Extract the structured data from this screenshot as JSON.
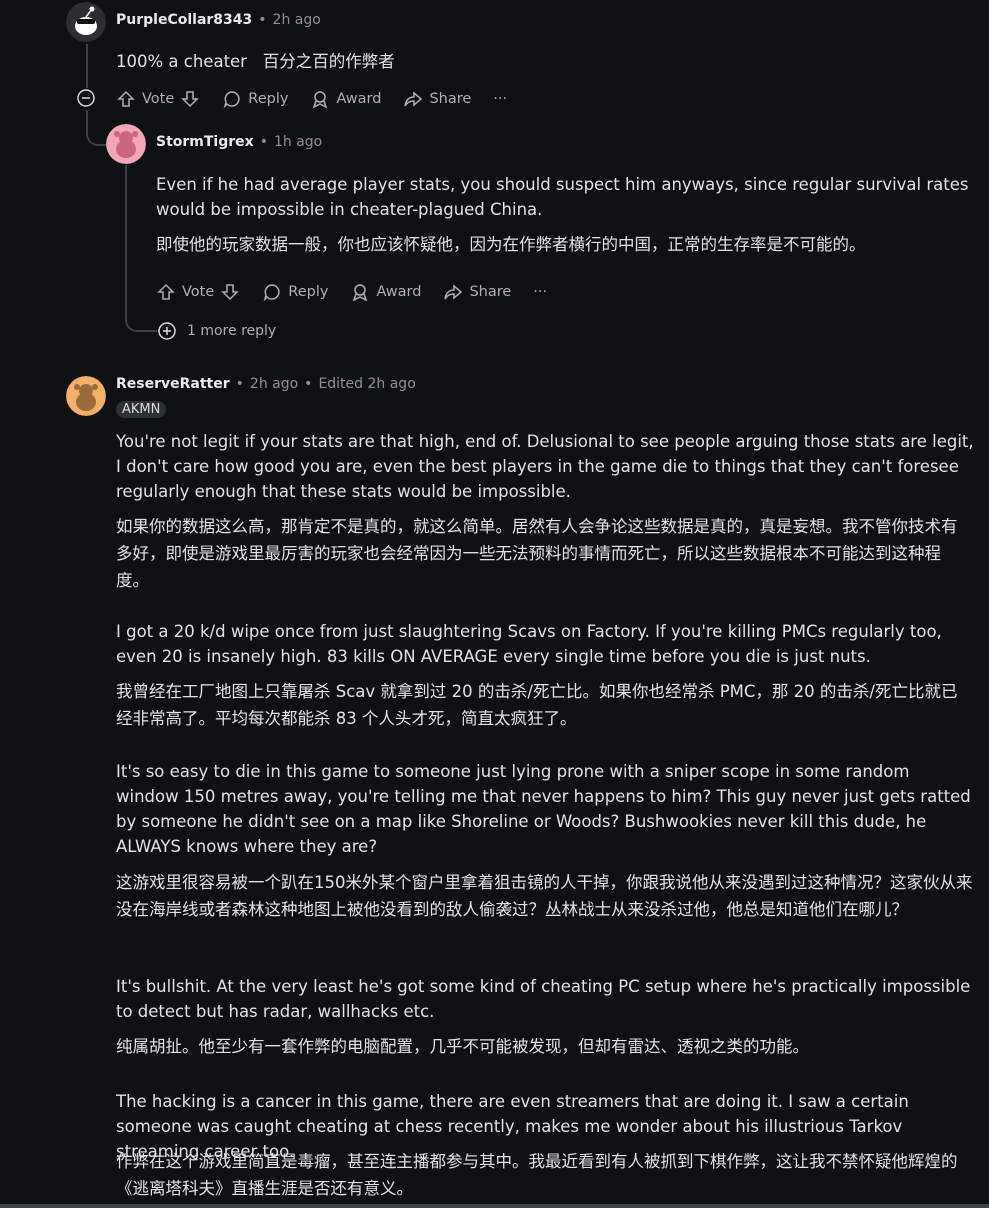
{
  "comment1": {
    "username": "PurpleCollar8343",
    "time": "2h ago",
    "text": "100% a cheater   百分之百的作弊者",
    "actions": {
      "vote": "Vote",
      "reply": "Reply",
      "award": "Award",
      "share": "Share",
      "more": "···"
    }
  },
  "comment2": {
    "username": "StormTigrex",
    "time": "1h ago",
    "text_en": "Even if he had average player stats, you should suspect him anyways, since regular survival rates would be impossible in cheater-plagued China.",
    "text_zh": "即使他的玩家数据一般，你也应该怀疑他，因为在作弊者横行的中国，正常的生存率是不可能的。",
    "actions": {
      "vote": "Vote",
      "reply": "Reply",
      "award": "Award",
      "share": "Share",
      "more": "···"
    },
    "more_replies": "1 more reply"
  },
  "comment3": {
    "username": "ReserveRatter",
    "time": "2h ago",
    "edited": "Edited 2h ago",
    "flair": "AKMN",
    "paragraphs": [
      {
        "en": "You're not legit if your stats are that high, end of. Delusional to see people arguing those stats are legit, I don't care how good you are, even the best players in the game die to things that they can't foresee regularly enough that these stats would be impossible.",
        "zh": "如果你的数据这么高，那肯定不是真的，就这么简单。居然有人会争论这些数据是真的，真是妄想。我不管你技术有多好，即使是游戏里最厉害的玩家也会经常因为一些无法预料的事情而死亡，所以这些数据根本不可能达到这种程度。"
      },
      {
        "en": "I got a 20 k/d wipe once from just slaughtering Scavs on Factory. If you're killing PMCs regularly too, even 20 is insanely high. 83 kills ON AVERAGE every single time before you die is just nuts.",
        "zh": "我曾经在工厂地图上只靠屠杀 Scav 就拿到过 20 的击杀/死亡比。如果你也经常杀 PMC，那 20 的击杀/死亡比就已经非常高了。平均每次都能杀 83 个人头才死，简直太疯狂了。"
      },
      {
        "en": "It's so easy to die in this game to someone just lying prone with a sniper scope in some random window 150 metres away, you're telling me that never happens to him? This guy never just gets ratted by someone he didn't see on a map like Shoreline or Woods? Bushwookies never kill this dude, he ALWAYS knows where they are?",
        "zh": "这游戏里很容易被一个趴在150米外某个窗户里拿着狙击镜的人干掉，你跟我说他从来没遇到过这种情况？这家伙从来没在海岸线或者森林这种地图上被他没看到的敌人偷袭过？丛林战士从来没杀过他，他总是知道他们在哪儿？"
      },
      {
        "en": "It's bullshit. At the very least he's got some kind of cheating PC setup where he's practically impossible to detect but has radar, wallhacks etc.",
        "zh": "纯属胡扯。他至少有一套作弊的电脑配置，几乎不可能被发现，但却有雷达、透视之类的功能。"
      },
      {
        "en": "The hacking is a cancer in this game, there are even streamers that are doing it. I saw a certain someone was caught cheating at chess recently, makes me wonder about his illustrious Tarkov streaming career too.",
        "zh": "作弊在这个游戏里简直是毒瘤，甚至连主播都参与其中。我最近看到有人被抓到下棋作弊，这让我不禁怀疑他辉煌的《逃离塔科夫》直播生涯是否还有意义。"
      }
    ]
  }
}
